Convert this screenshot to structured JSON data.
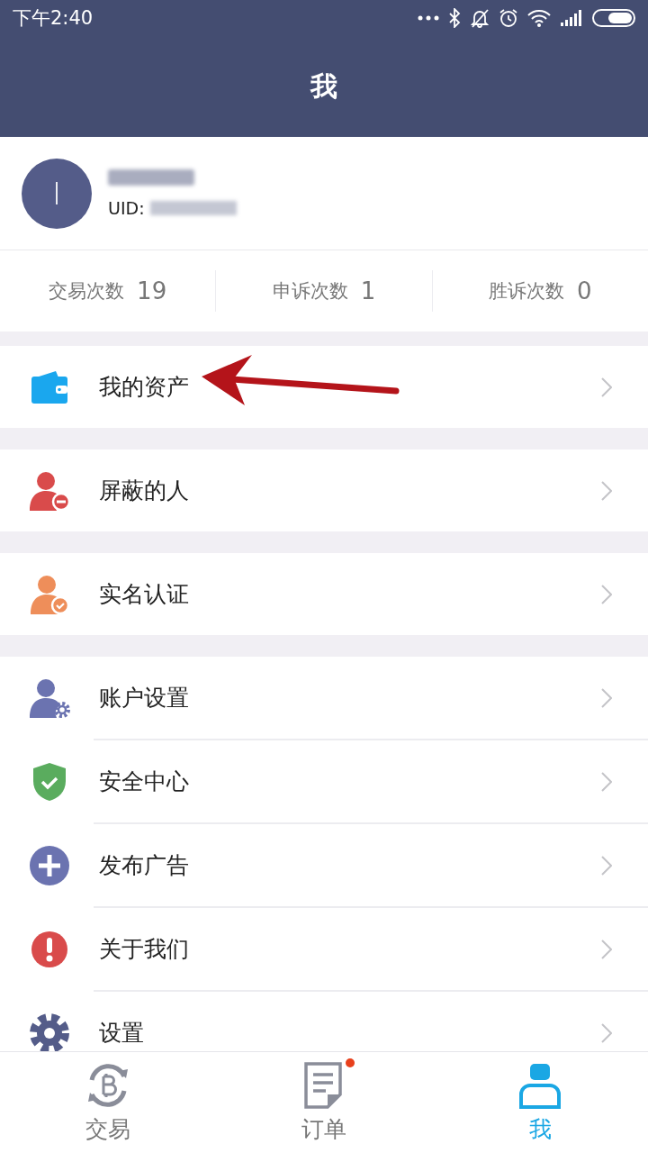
{
  "status_bar": {
    "time": "下午2:40"
  },
  "header": {
    "title": "我"
  },
  "profile": {
    "avatar_initial": "I",
    "uid_label": "UID:"
  },
  "stats": [
    {
      "label": "交易次数",
      "value": "19"
    },
    {
      "label": "申诉次数",
      "value": "1"
    },
    {
      "label": "胜诉次数",
      "value": "0"
    }
  ],
  "menu_groups": [
    [
      {
        "kind": "wallet",
        "label": "我的资产"
      }
    ],
    [
      {
        "kind": "blocked",
        "label": "屏蔽的人"
      }
    ],
    [
      {
        "kind": "verified",
        "label": "实名认证"
      }
    ],
    [
      {
        "kind": "account",
        "label": "账户设置"
      },
      {
        "kind": "shield",
        "label": "安全中心"
      },
      {
        "kind": "plus",
        "label": "发布广告"
      },
      {
        "kind": "alert",
        "label": "关于我们"
      },
      {
        "kind": "gear",
        "label": "设置"
      }
    ]
  ],
  "arrow_annotation": true,
  "tabs": [
    {
      "kind": "exchange",
      "label": "交易",
      "selected": false,
      "badge": false
    },
    {
      "kind": "orders",
      "label": "订单",
      "selected": false,
      "badge": true
    },
    {
      "kind": "me",
      "label": "我",
      "selected": true,
      "badge": false
    }
  ]
}
